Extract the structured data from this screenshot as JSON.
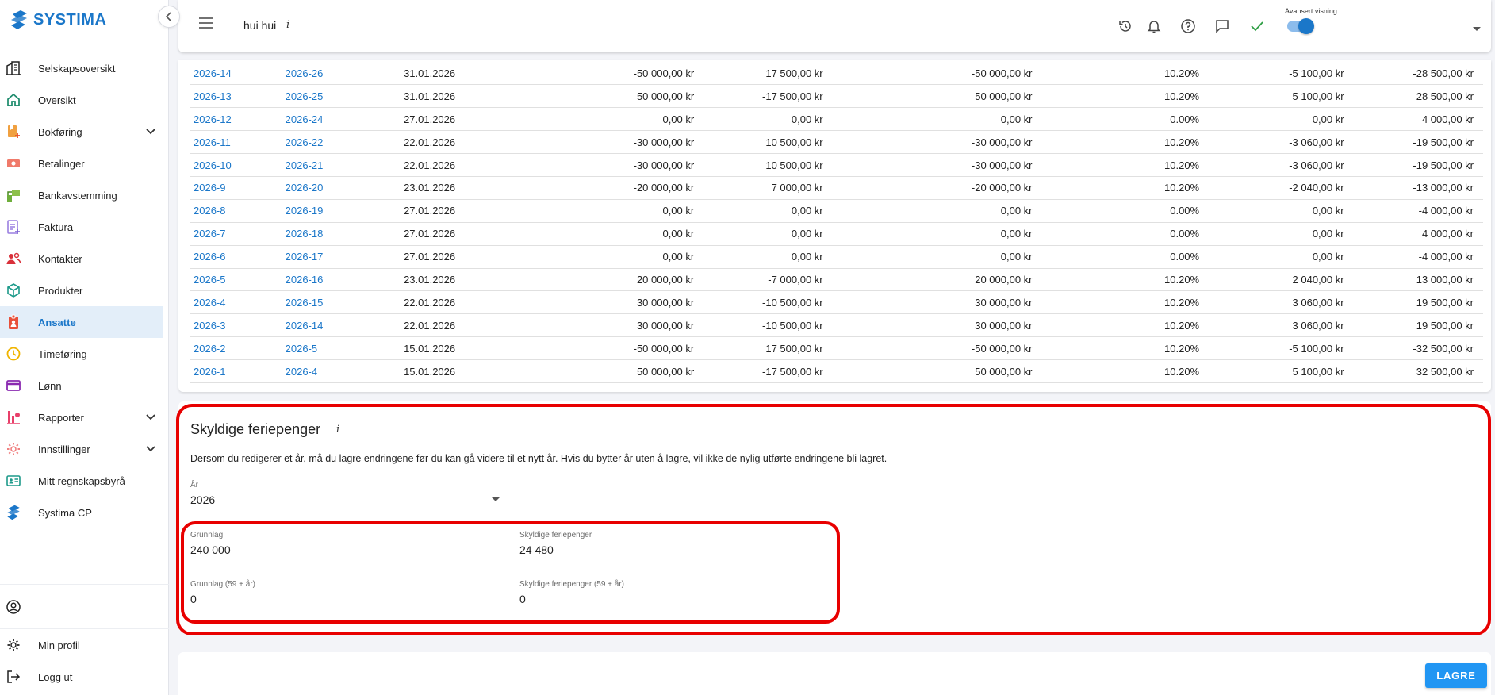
{
  "brand": {
    "name": "SYSTIMA",
    "accent": "#1b77c9",
    "highlight": "#e80000"
  },
  "sidebar": {
    "items": [
      {
        "label": "Selskapsoversikt",
        "icon": "buildings-icon"
      },
      {
        "label": "Oversikt",
        "icon": "home-icon"
      },
      {
        "label": "Bokføring",
        "icon": "bookkeeping-icon",
        "expandable": true
      },
      {
        "label": "Betalinger",
        "icon": "money-icon"
      },
      {
        "label": "Bankavstemming",
        "icon": "bank-icon"
      },
      {
        "label": "Faktura",
        "icon": "invoice-icon"
      },
      {
        "label": "Kontakter",
        "icon": "contacts-icon"
      },
      {
        "label": "Produkter",
        "icon": "box-icon"
      },
      {
        "label": "Ansatte",
        "icon": "employee-badge-icon",
        "active": true
      },
      {
        "label": "Timeføring",
        "icon": "clock-icon"
      },
      {
        "label": "Lønn",
        "icon": "card-icon"
      },
      {
        "label": "Rapporter",
        "icon": "reports-icon",
        "expandable": true
      },
      {
        "label": "Innstillinger",
        "icon": "gear-icon",
        "expandable": true
      },
      {
        "label": "Mitt regnskapsbyrå",
        "icon": "id-card-icon"
      },
      {
        "label": "Systima CP",
        "icon": "systima-logo-icon"
      }
    ],
    "bottom": {
      "profile_label": "Min profil",
      "logout_label": "Logg ut"
    }
  },
  "header": {
    "company": "hui hui",
    "info_symbol": "i",
    "advanced_view_label": "Avansert visning",
    "advanced_view_on": true
  },
  "table": {
    "rows": [
      [
        "2026-14",
        "2026-26",
        "31.01.2026",
        "-50 000,00 kr",
        "17 500,00 kr",
        "-50 000,00 kr",
        "10.20%",
        "-5 100,00 kr",
        "-28 500,00 kr"
      ],
      [
        "2026-13",
        "2026-25",
        "31.01.2026",
        "50 000,00 kr",
        "-17 500,00 kr",
        "50 000,00 kr",
        "10.20%",
        "5 100,00 kr",
        "28 500,00 kr"
      ],
      [
        "2026-12",
        "2026-24",
        "27.01.2026",
        "0,00 kr",
        "0,00 kr",
        "0,00 kr",
        "0.00%",
        "0,00 kr",
        "4 000,00 kr"
      ],
      [
        "2026-11",
        "2026-22",
        "22.01.2026",
        "-30 000,00 kr",
        "10 500,00 kr",
        "-30 000,00 kr",
        "10.20%",
        "-3 060,00 kr",
        "-19 500,00 kr"
      ],
      [
        "2026-10",
        "2026-21",
        "22.01.2026",
        "-30 000,00 kr",
        "10 500,00 kr",
        "-30 000,00 kr",
        "10.20%",
        "-3 060,00 kr",
        "-19 500,00 kr"
      ],
      [
        "2026-9",
        "2026-20",
        "23.01.2026",
        "-20 000,00 kr",
        "7 000,00 kr",
        "-20 000,00 kr",
        "10.20%",
        "-2 040,00 kr",
        "-13 000,00 kr"
      ],
      [
        "2026-8",
        "2026-19",
        "27.01.2026",
        "0,00 kr",
        "0,00 kr",
        "0,00 kr",
        "0.00%",
        "0,00 kr",
        "-4 000,00 kr"
      ],
      [
        "2026-7",
        "2026-18",
        "27.01.2026",
        "0,00 kr",
        "0,00 kr",
        "0,00 kr",
        "0.00%",
        "0,00 kr",
        "4 000,00 kr"
      ],
      [
        "2026-6",
        "2026-17",
        "27.01.2026",
        "0,00 kr",
        "0,00 kr",
        "0,00 kr",
        "0.00%",
        "0,00 kr",
        "-4 000,00 kr"
      ],
      [
        "2026-5",
        "2026-16",
        "23.01.2026",
        "20 000,00 kr",
        "-7 000,00 kr",
        "20 000,00 kr",
        "10.20%",
        "2 040,00 kr",
        "13 000,00 kr"
      ],
      [
        "2026-4",
        "2026-15",
        "22.01.2026",
        "30 000,00 kr",
        "-10 500,00 kr",
        "30 000,00 kr",
        "10.20%",
        "3 060,00 kr",
        "19 500,00 kr"
      ],
      [
        "2026-3",
        "2026-14",
        "22.01.2026",
        "30 000,00 kr",
        "-10 500,00 kr",
        "30 000,00 kr",
        "10.20%",
        "3 060,00 kr",
        "19 500,00 kr"
      ],
      [
        "2026-2",
        "2026-5",
        "15.01.2026",
        "-50 000,00 kr",
        "17 500,00 kr",
        "-50 000,00 kr",
        "10.20%",
        "-5 100,00 kr",
        "-32 500,00 kr"
      ],
      [
        "2026-1",
        "2026-4",
        "15.01.2026",
        "50 000,00 kr",
        "-17 500,00 kr",
        "50 000,00 kr",
        "10.20%",
        "5 100,00 kr",
        "32 500,00 kr"
      ]
    ]
  },
  "feriepenger": {
    "title": "Skyldige feriepenger",
    "description": "Dersom du redigerer et år, må du lagre endringene før du kan gå videre til et nytt år. Hvis du bytter år uten å lagre, vil ikke de nylig utførte endringene bli lagret.",
    "year_label": "År",
    "year_value": "2026",
    "grunnlag_label": "Grunnlag",
    "grunnlag_value": "240 000",
    "skyldige_label": "Skyldige feriepenger",
    "skyldige_value": "24 480",
    "grunnlag59_label": "Grunnlag (59 + år)",
    "grunnlag59_value": "0",
    "skyldige59_label": "Skyldige feriepenger (59 + år)",
    "skyldige59_value": "0"
  },
  "actions": {
    "save_label": "LAGRE"
  }
}
